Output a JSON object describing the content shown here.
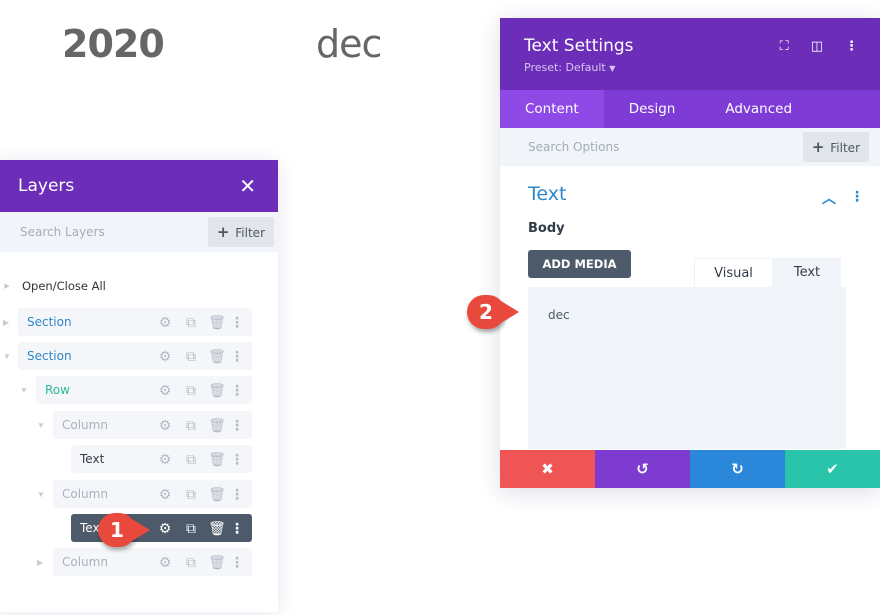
{
  "page": {
    "year": "2020",
    "month": "dec"
  },
  "layers": {
    "title": "Layers",
    "close_icon": "✕",
    "search_placeholder": "Search Layers",
    "filter_label": "Filter",
    "open_close_all": "Open/Close All",
    "tool_icons": {
      "settings": "⚙",
      "duplicate": "⧉",
      "delete": "🗑",
      "more": "⋮"
    },
    "rows": [
      {
        "label": "Section",
        "type": "section",
        "expanded": false
      },
      {
        "label": "Section",
        "type": "section",
        "expanded": true
      },
      {
        "label": "Row",
        "type": "row",
        "expanded": true
      },
      {
        "label": "Column",
        "type": "column",
        "expanded": true
      },
      {
        "label": "Text",
        "type": "text"
      },
      {
        "label": "Column",
        "type": "column",
        "expanded": true
      },
      {
        "label": "Text",
        "type": "text",
        "active": true
      },
      {
        "label": "Column",
        "type": "column",
        "expanded": false
      }
    ]
  },
  "settings": {
    "title": "Text Settings",
    "preset": "Preset: Default",
    "tabs": [
      "Content",
      "Design",
      "Advanced"
    ],
    "active_tab": "Content",
    "search_placeholder": "Search Options",
    "filter_label": "Filter",
    "group_title": "Text",
    "body_label": "Body",
    "add_media": "ADD MEDIA",
    "editor_tabs": [
      "Visual",
      "Text"
    ],
    "editor_content": "dec",
    "footer": {
      "cancel": "✖",
      "undo": "↺",
      "redo": "↻",
      "save": "✔"
    },
    "colors": {
      "cancel": "#ef5555",
      "undo": "#7e3bd0",
      "redo": "#2b87da",
      "save": "#29c4a9"
    }
  },
  "callouts": [
    "1",
    "2"
  ]
}
